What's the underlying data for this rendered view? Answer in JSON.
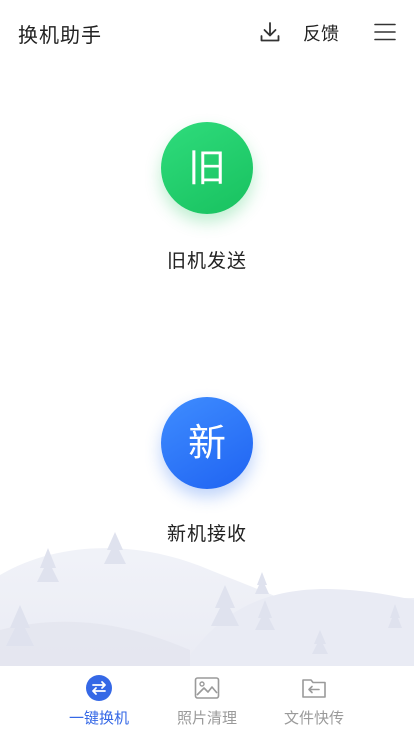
{
  "header": {
    "title": "换机助手",
    "download_icon": "download-icon",
    "feedback_label": "反馈",
    "menu_icon": "menu-icon"
  },
  "actions": {
    "old_phone": {
      "glyph": "旧",
      "label": "旧机发送",
      "color": "#22c96a"
    },
    "new_phone": {
      "glyph": "新",
      "label": "新机接收",
      "color": "#2f74fa"
    }
  },
  "bottom_nav": {
    "items": [
      {
        "label": "一键换机",
        "icon": "swap-icon",
        "active": true
      },
      {
        "label": "照片清理",
        "icon": "image-icon",
        "active": false
      },
      {
        "label": "文件快传",
        "icon": "folder-transfer-icon",
        "active": false
      }
    ]
  },
  "colors": {
    "accent": "#3568e6",
    "inactive": "#9a9a9a",
    "scenery": "#eceef6"
  }
}
